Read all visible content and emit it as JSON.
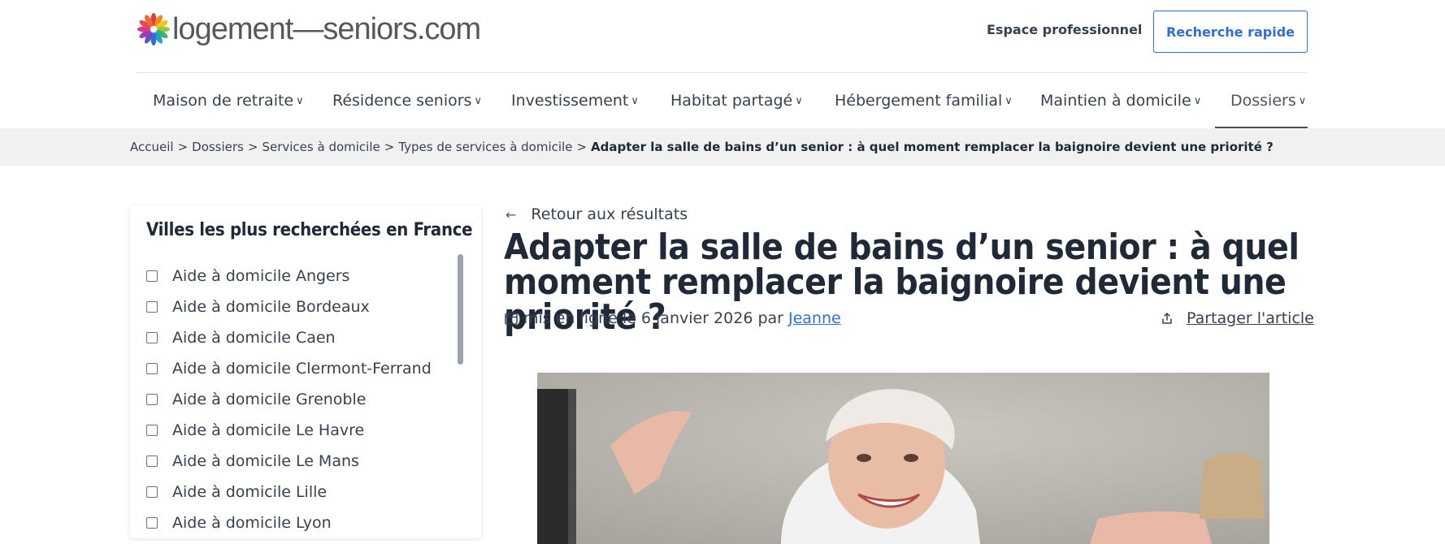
{
  "header": {
    "logo_text": "logement—seniors.com",
    "pro_link": "Espace professionnel",
    "quick_search": "Recherche rapide"
  },
  "nav": {
    "items": [
      {
        "label": "Maison de retraite"
      },
      {
        "label": "Résidence seniors"
      },
      {
        "label": "Investissement"
      },
      {
        "label": "Habitat partagé"
      },
      {
        "label": "Hébergement familial"
      },
      {
        "label": "Maintien à domicile"
      },
      {
        "label": "Dossiers"
      }
    ],
    "active": "Dossiers"
  },
  "breadcrumb": {
    "items": [
      "Accueil",
      "Dossiers",
      "Services à domicile",
      "Types de services à domicile"
    ],
    "separator": ">",
    "current": "Adapter la salle de bains d’un senior : à quel moment remplacer la baignoire devient une priorité ?"
  },
  "sidebar": {
    "title": "Villes les plus recherchées en France",
    "cities": [
      "Aide à domicile Angers",
      "Aide à domicile Bordeaux",
      "Aide à domicile Caen",
      "Aide à domicile Clermont-Ferrand",
      "Aide à domicile Grenoble",
      "Aide à domicile Le Havre",
      "Aide à domicile Le Mans",
      "Aide à domicile Lille",
      "Aide à domicile Lyon"
    ]
  },
  "article": {
    "back_label": "Retour aux résultats",
    "title": "Adapter la salle de bains d’un senior : à quel moment remplacer la baignoire devient une priorité ?",
    "meta_prefix": "mis en ligne le 6 janvier 2026 par",
    "author": "Jeanne",
    "share_label": "Partager l'article"
  },
  "colors": {
    "accent": "#2f6fd1",
    "breadcrumb_bg": "#f1f1f1",
    "nav_active_bar": "#4b4f55"
  },
  "icons": [
    "flower-logo-icon",
    "chevron-down-icon",
    "arrow-left-icon",
    "calendar-icon",
    "share-icon"
  ]
}
